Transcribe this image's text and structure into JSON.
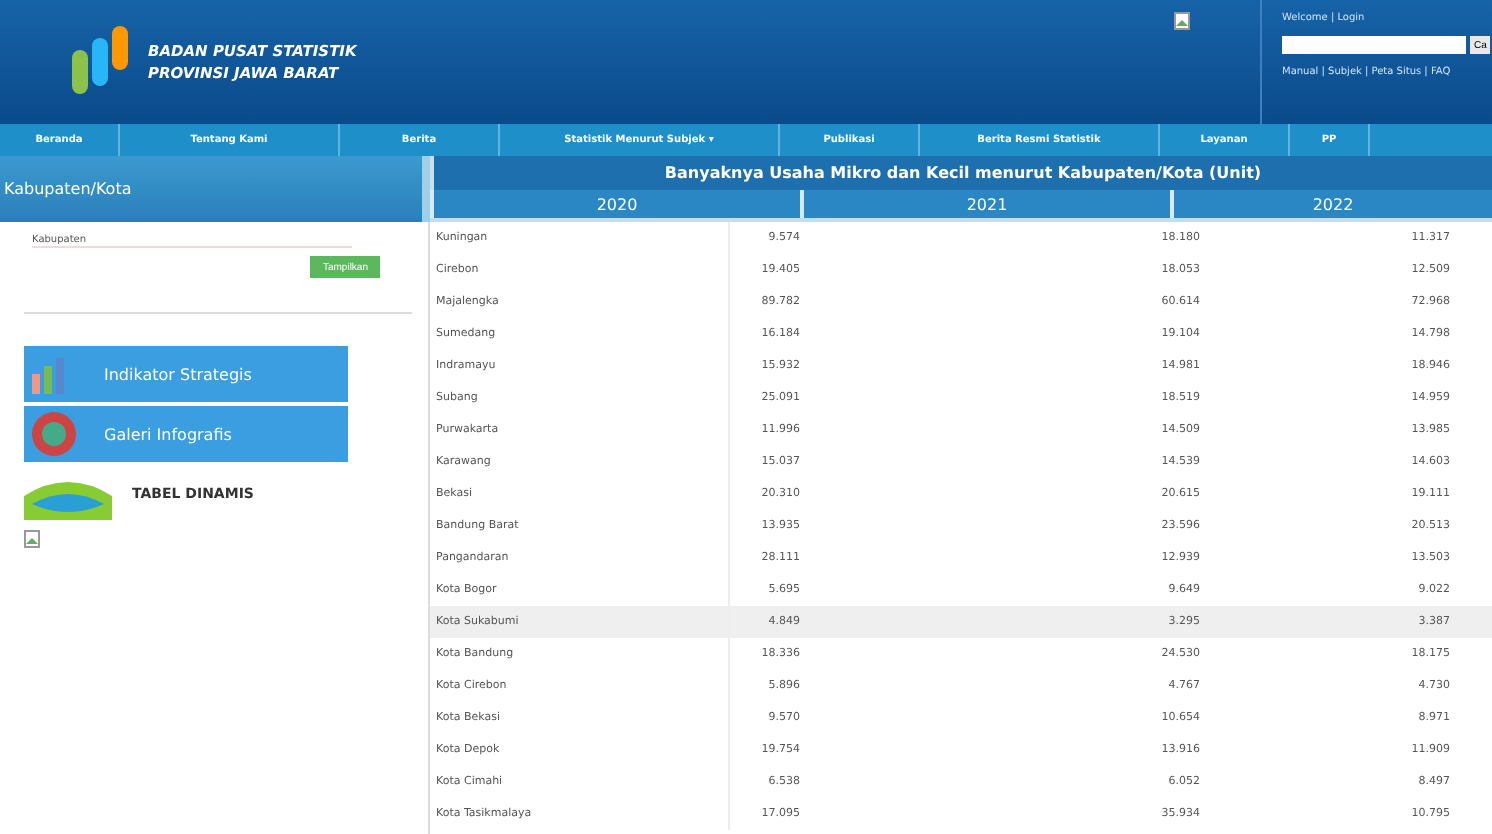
{
  "header": {
    "org_line_1": "BADAN PUSAT STATISTIK",
    "org_line_2": "PROVINSI JAWA BARAT",
    "login": "Welcome | Login",
    "search_button": "Ca",
    "links": "Manual | Subjek | Peta Situs | FAQ"
  },
  "nav": [
    {
      "label": "Beranda"
    },
    {
      "label": "Tentang Kami"
    },
    {
      "label": "Berita"
    },
    {
      "label": "Statistik Menurut Subjek ▾"
    },
    {
      "label": "Publikasi"
    },
    {
      "label": "Berita Resmi Statistik"
    },
    {
      "label": "Layanan"
    },
    {
      "label": "PP"
    }
  ],
  "sidebar": {
    "heading": "Kabupaten/Kota",
    "filter_label": "Kabupaten",
    "filter_button": "Tampilkan",
    "banners": [
      {
        "kind": "chart",
        "label": "Indikator Strategis"
      },
      {
        "kind": "globe",
        "label": "Galeri Infografis"
      },
      {
        "kind": "wave",
        "label": "TABEL DINAMIS"
      }
    ]
  },
  "table": {
    "title": "Banyaknya Usaha Mikro dan Kecil menurut Kabupaten/Kota (Unit)",
    "columns": [
      "2020",
      "2021",
      "2022"
    ],
    "rows": [
      {
        "name": "Kuningan",
        "values": [
          "9.574",
          "18.180",
          "11.317"
        ],
        "selected": false
      },
      {
        "name": "Cirebon",
        "values": [
          "19.405",
          "18.053",
          "12.509"
        ],
        "selected": false
      },
      {
        "name": "Majalengka",
        "values": [
          "89.782",
          "60.614",
          "72.968"
        ],
        "selected": false
      },
      {
        "name": "Sumedang",
        "values": [
          "16.184",
          "19.104",
          "14.798"
        ],
        "selected": false
      },
      {
        "name": "Indramayu",
        "values": [
          "15.932",
          "14.981",
          "18.946"
        ],
        "selected": false
      },
      {
        "name": "Subang",
        "values": [
          "25.091",
          "18.519",
          "14.959"
        ],
        "selected": false
      },
      {
        "name": "Purwakarta",
        "values": [
          "11.996",
          "14.509",
          "13.985"
        ],
        "selected": false
      },
      {
        "name": "Karawang",
        "values": [
          "15.037",
          "14.539",
          "14.603"
        ],
        "selected": false
      },
      {
        "name": "Bekasi",
        "values": [
          "20.310",
          "20.615",
          "19.111"
        ],
        "selected": false
      },
      {
        "name": "Bandung Barat",
        "values": [
          "13.935",
          "23.596",
          "20.513"
        ],
        "selected": false
      },
      {
        "name": "Pangandaran",
        "values": [
          "28.111",
          "12.939",
          "13.503"
        ],
        "selected": false
      },
      {
        "name": "Kota Bogor",
        "values": [
          "5.695",
          "9.649",
          "9.022"
        ],
        "selected": false
      },
      {
        "name": "Kota Sukabumi",
        "values": [
          "4.849",
          "3.295",
          "3.387"
        ],
        "selected": true
      },
      {
        "name": "Kota Bandung",
        "values": [
          "18.336",
          "24.530",
          "18.175"
        ],
        "selected": false
      },
      {
        "name": "Kota Cirebon",
        "values": [
          "5.896",
          "4.767",
          "4.730"
        ],
        "selected": false
      },
      {
        "name": "Kota Bekasi",
        "values": [
          "9.570",
          "10.654",
          "8.971"
        ],
        "selected": false
      },
      {
        "name": "Kota Depok",
        "values": [
          "19.754",
          "13.916",
          "11.909"
        ],
        "selected": false
      },
      {
        "name": "Kota Cimahi",
        "values": [
          "6.538",
          "6.052",
          "8.497"
        ],
        "selected": false
      },
      {
        "name": "Kota Tasikmalaya",
        "values": [
          "17.095",
          "35.934",
          "10.795"
        ],
        "selected": false
      }
    ]
  }
}
